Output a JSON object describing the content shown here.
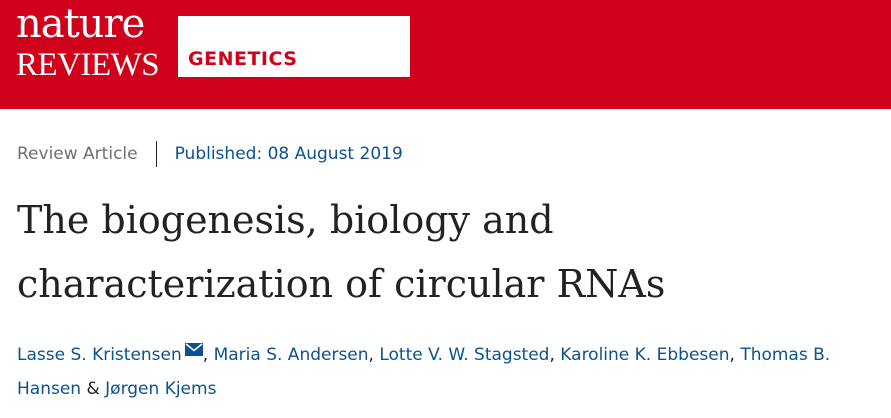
{
  "header": {
    "logo_line1": "nature",
    "logo_line2": "REVIEWS",
    "journal": "GENETICS",
    "banner_color": "#d0021b"
  },
  "meta": {
    "article_type": "Review Article",
    "published": "Published: 08 August 2019"
  },
  "article": {
    "title_line1": "The biogenesis, biology and",
    "title_line2": "characterization of circular RNAs"
  },
  "authors": {
    "list": [
      "Lasse S. Kristensen",
      "Maria S. Andersen",
      "Lotte V. W. Stagsted",
      "Karoline K. Ebbesen",
      "Thomas B. Hansen",
      "Jørgen Kjems"
    ],
    "separator": ", ",
    "ampersand": "&",
    "corresponding_icon": "envelope-icon"
  },
  "colors": {
    "link": "#0c5290",
    "muted": "#6f6f6f",
    "text": "#222222"
  }
}
